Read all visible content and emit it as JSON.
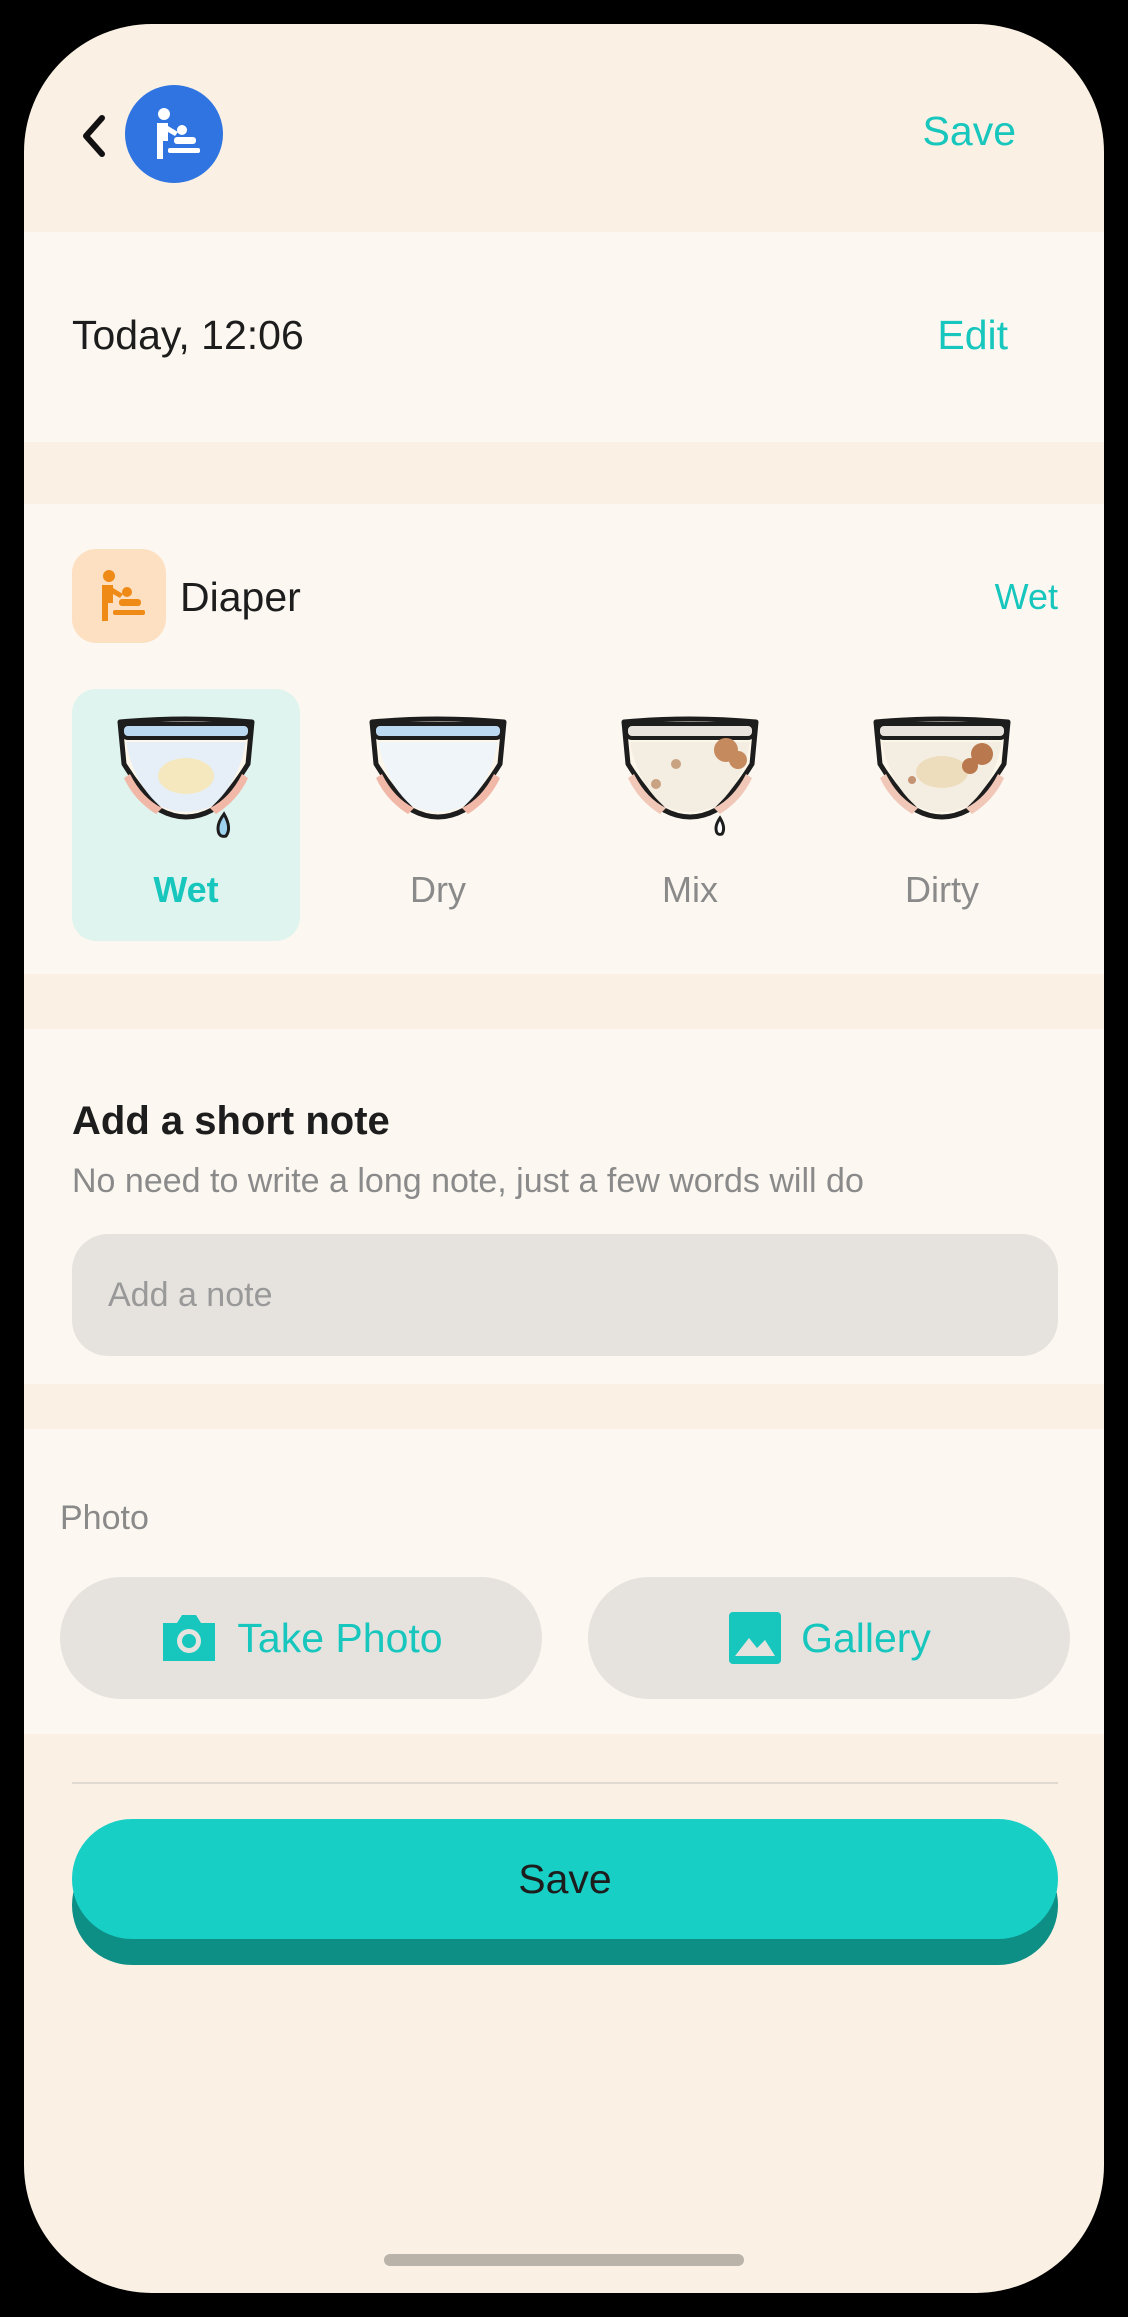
{
  "header": {
    "back_icon": "chevron-left-icon",
    "avatar_icon": "baby-changing-icon",
    "save_label": "Save"
  },
  "datetime": {
    "value": "Today, 12:06",
    "edit_label": "Edit"
  },
  "diaper": {
    "icon": "baby-changing-icon",
    "title": "Diaper",
    "selected_value": "Wet",
    "options": [
      {
        "label": "Wet",
        "selected": true
      },
      {
        "label": "Dry",
        "selected": false
      },
      {
        "label": "Mix",
        "selected": false
      },
      {
        "label": "Dirty",
        "selected": false
      }
    ]
  },
  "note": {
    "title": "Add a short note",
    "subtitle": "No need to write a long note, just a few words will do",
    "placeholder": "Add a note",
    "value": ""
  },
  "photo": {
    "label": "Photo",
    "take_photo_label": "Take Photo",
    "take_photo_icon": "camera-icon",
    "gallery_label": "Gallery",
    "gallery_icon": "image-icon"
  },
  "footer": {
    "save_label": "Save"
  },
  "colors": {
    "accent": "#17c6bd",
    "background": "#faf1e4",
    "card": "#fcf8f1",
    "selected_option_bg": "#dff4ee",
    "header_avatar": "#2f74e0",
    "diaper_icon_bg": "#fde0c2"
  }
}
